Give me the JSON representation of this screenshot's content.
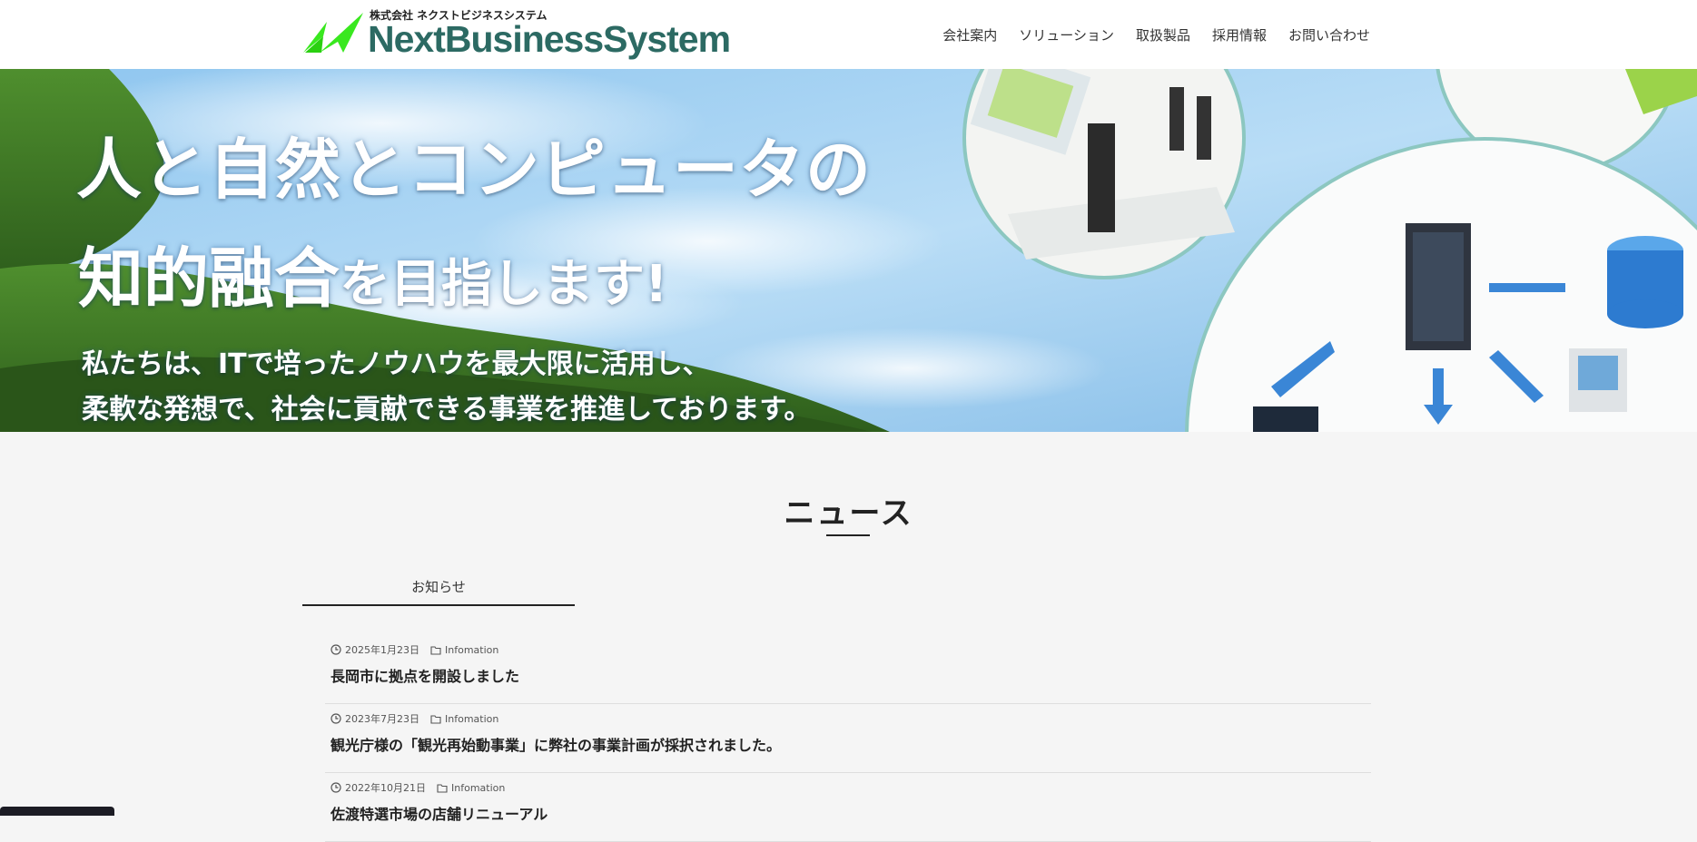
{
  "header": {
    "logo_sub": "株式会社 ネクストビジネスシステム",
    "logo_main": "NextBusinessSystem",
    "nav": [
      "会社案内",
      "ソリューション",
      "取扱製品",
      "採用情報",
      "お問い合わせ"
    ]
  },
  "hero": {
    "line1": "人と自然とコンピュータの",
    "line2_big": "知的融合",
    "line2_small": "を目指します!",
    "line3": "私たちは、ITで培ったノウハウを最大限に活用し、",
    "line4": "柔軟な発想で、社会に貢献できる事業を推進しております。"
  },
  "news": {
    "title": "ニュース",
    "tab_label": "お知らせ",
    "items": [
      {
        "date": "2025年1月23日",
        "category": "Infomation",
        "headline": "長岡市に拠点を開設しました"
      },
      {
        "date": "2023年7月23日",
        "category": "Infomation",
        "headline": "観光庁様の「観光再始動事業」に弊社の事業計画が採択されました。"
      },
      {
        "date": "2022年10月21日",
        "category": "Infomation",
        "headline": "佐渡特選市場の店舗リニューアル"
      }
    ]
  },
  "colors": {
    "brand_green": "#2c6a63",
    "logo_accent": "#39e81f"
  },
  "icons": {
    "clock": "clock-icon",
    "folder": "folder-icon"
  }
}
